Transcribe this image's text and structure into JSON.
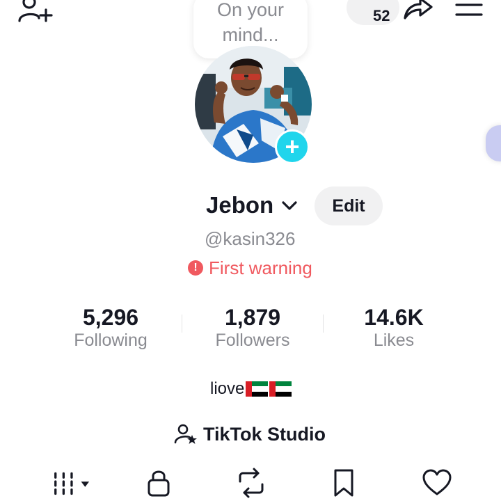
{
  "top_bar": {
    "thought_bubble": "On your mind...",
    "share_count": "52",
    "icons": [
      "add-friend-icon",
      "share-icon",
      "menu-icon"
    ]
  },
  "profile": {
    "display_name": "Jebon",
    "edit_label": "Edit",
    "username": "@kasin326",
    "warning_text": "First warning",
    "bio_text": "liove",
    "bio_flags": [
      "United Arab Emirates flag",
      "United Arab Emirates flag"
    ]
  },
  "stats": [
    {
      "value": "5,296",
      "label": "Following"
    },
    {
      "value": "1,879",
      "label": "Followers"
    },
    {
      "value": "14.6K",
      "label": "Likes"
    }
  ],
  "studio": {
    "label": "TikTok Studio"
  },
  "tabs": [
    {
      "name": "videos-grid-icon",
      "active": true
    },
    {
      "name": "lock-icon",
      "active": false
    },
    {
      "name": "repost-icon",
      "active": false
    },
    {
      "name": "bookmark-icon",
      "active": false
    },
    {
      "name": "heart-icon",
      "active": false
    }
  ],
  "colors": {
    "accent_cyan": "#20d5ec",
    "warning_red": "#f0595f",
    "text_primary": "#161823",
    "text_secondary": "#8a8b91",
    "pill_bg": "#f1f1f2"
  }
}
